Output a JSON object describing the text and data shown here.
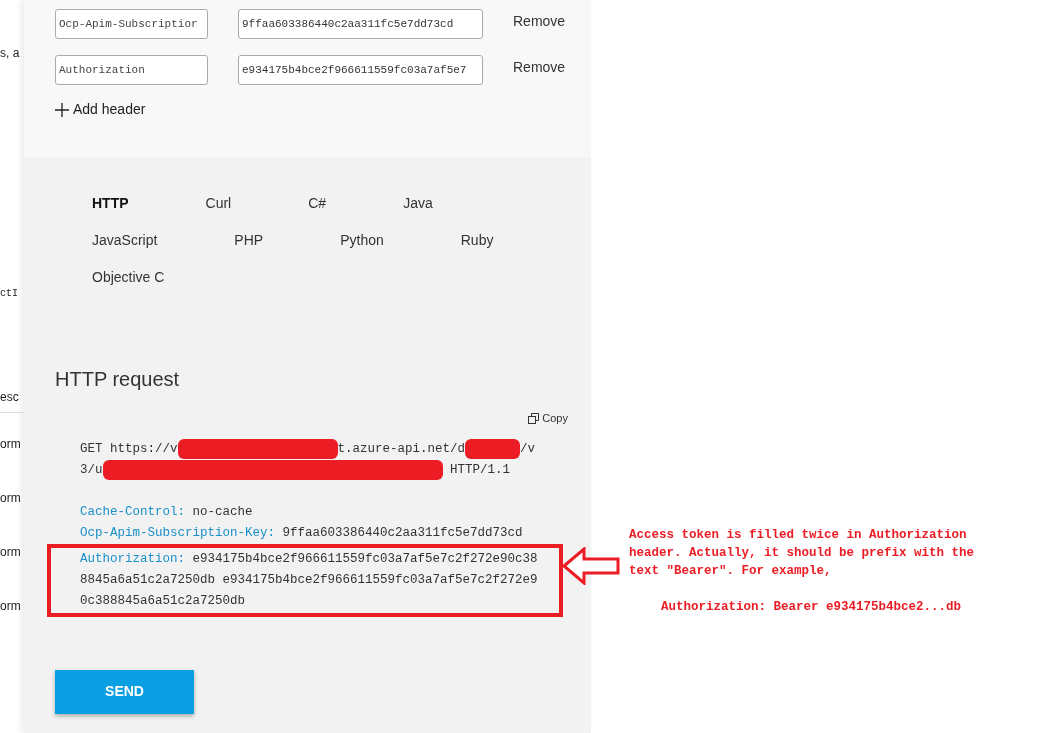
{
  "left_fragments": [
    {
      "text": "s, a",
      "kind": "sans"
    },
    {
      "text": "ctI",
      "kind": "mono"
    },
    {
      "text": "esc",
      "kind": "sans"
    },
    {
      "text": "orm",
      "kind": "sans"
    },
    {
      "text": "orm",
      "kind": "sans"
    },
    {
      "text": "orm",
      "kind": "sans"
    },
    {
      "text": "orm",
      "kind": "sans"
    }
  ],
  "headers": [
    {
      "name": "Ocp-Apim-Subscriptior",
      "value": "9ffaa603386440c2aa311fc5e7dd73cd",
      "remove": "Remove"
    },
    {
      "name": "Authorization",
      "value": "e934175b4bce2f966611559fc03a7af5e7",
      "remove": "Remove"
    }
  ],
  "add_header": "Add header",
  "languages": [
    {
      "label": "HTTP",
      "selected": true
    },
    {
      "label": "Curl",
      "selected": false
    },
    {
      "label": "C#",
      "selected": false
    },
    {
      "label": "Java",
      "selected": false
    },
    {
      "label": "JavaScript",
      "selected": false
    },
    {
      "label": "PHP",
      "selected": false
    },
    {
      "label": "Python",
      "selected": false
    },
    {
      "label": "Ruby",
      "selected": false
    },
    {
      "label": "Objective C",
      "selected": false
    }
  ],
  "request": {
    "title": "HTTP request",
    "copy": "Copy",
    "url_lines": [
      [
        {
          "kind": "text",
          "text": "GET https://v"
        },
        {
          "kind": "redaction"
        },
        {
          "kind": "text",
          "text": "t.azure-api.net/d"
        },
        {
          "kind": "redaction"
        },
        {
          "kind": "text",
          "text": "/v"
        }
      ],
      [
        {
          "kind": "text",
          "text": "3/u"
        },
        {
          "kind": "redaction"
        },
        {
          "kind": "text",
          "text": " HTTP/1.1"
        }
      ]
    ],
    "header_lines": [
      {
        "name": "Cache-Control:",
        "value": "no-cache",
        "highlighted": false
      },
      {
        "name": "Ocp-Apim-Subscription-Key:",
        "value": "9ffaa603386440c2aa311fc5e7dd73cd",
        "highlighted": false
      },
      {
        "name": "Authorization:",
        "value": "e934175b4bce2f966611559fc03a7af5e7c2f272e90c388845a6a51c2a7250db e934175b4bce2f966611559fc03a7af5e7c2f272e90c388845a6a51c2a7250db",
        "highlighted": true
      }
    ]
  },
  "send": "SEND",
  "annotation": {
    "note": "Access token is filled twice in Authorization header. Actually, it should be prefix with the text \"Bearer\". For example,",
    "example": "Authorization: Bearer e934175b4bce2...db"
  }
}
